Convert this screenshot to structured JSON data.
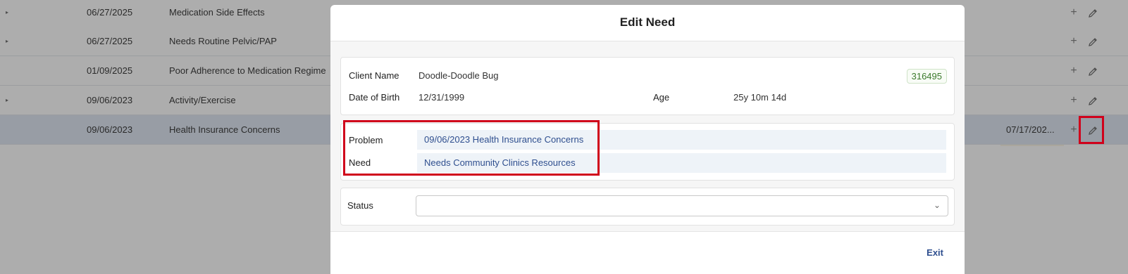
{
  "table": {
    "rows": [
      {
        "caret": "▸",
        "date": "06/27/2025",
        "name": "Medication Side Effects",
        "date2": "",
        "plus": "+"
      },
      {
        "caret": "▸",
        "date": "06/27/2025",
        "name": "Needs Routine Pelvic/PAP",
        "date2": "",
        "plus": "+"
      },
      {
        "caret": "",
        "date": "01/09/2025",
        "name": "Poor Adherence to Medication Regime",
        "date2": "",
        "plus": "+"
      },
      {
        "caret": "▸",
        "date": "09/06/2023",
        "name": "Activity/Exercise",
        "date2": "",
        "plus": "+"
      },
      {
        "caret": "",
        "date": "09/06/2023",
        "name": "Health Insurance Concerns",
        "date2": "07/17/202...",
        "plus": "+"
      }
    ]
  },
  "modal": {
    "title": "Edit Need",
    "client": {
      "name_label": "Client Name",
      "name_value": "Doodle-Doodle Bug",
      "id": "316495",
      "dob_label": "Date of Birth",
      "dob_value": "12/31/1999",
      "age_label": "Age",
      "age_value": "25y 10m 14d"
    },
    "problem_label": "Problem",
    "problem_value": "09/06/2023 Health Insurance Concerns",
    "need_label": "Need",
    "need_value": "Needs Community Clinics Resources",
    "status_label": "Status",
    "status_value": "",
    "exit_label": "Exit"
  },
  "colors": {
    "highlight": "#d0021b",
    "link": "#2f4f8f",
    "id_badge": "#3c7a2c"
  }
}
